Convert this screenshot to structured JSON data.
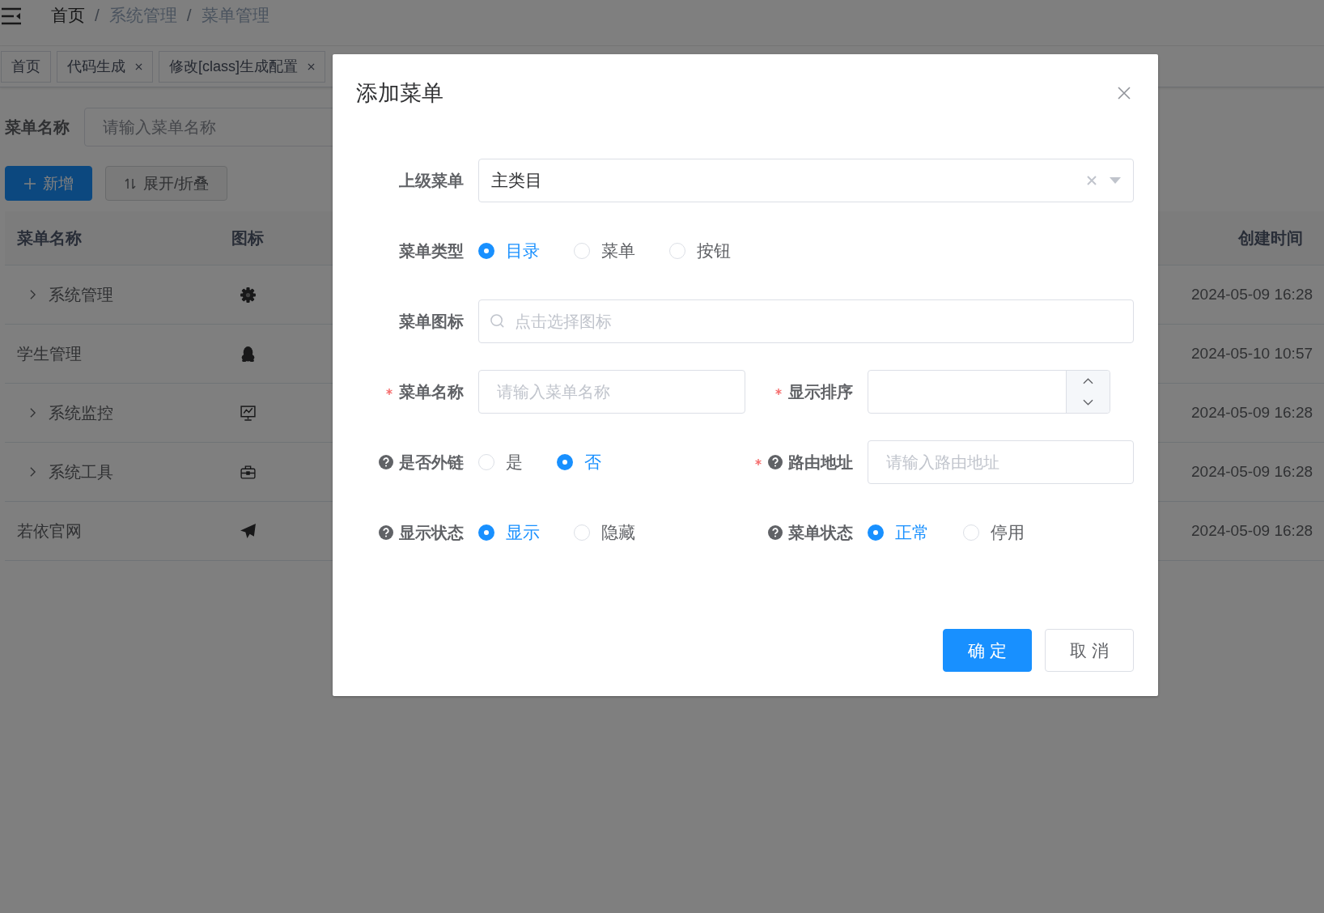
{
  "header": {
    "breadcrumb": [
      {
        "label": "首页",
        "link": true
      },
      {
        "label": "系统管理",
        "link": false
      },
      {
        "label": "菜单管理",
        "link": false
      }
    ],
    "separator": "/"
  },
  "tabs": [
    {
      "label": "首页",
      "closable": false
    },
    {
      "label": "代码生成",
      "closable": true
    },
    {
      "label": "修改[class]生成配置",
      "closable": true
    }
  ],
  "search": {
    "label": "菜单名称",
    "placeholder": "请输入菜单名称"
  },
  "toolbar": [
    {
      "label": "新增",
      "kind": "primary"
    },
    {
      "label": "展开/折叠",
      "kind": "plain"
    }
  ],
  "table": {
    "columns": [
      "菜单名称",
      "图标",
      "创建时间"
    ],
    "rows": [
      {
        "name": "系统管理",
        "expandable": true,
        "created": "2024-05-09 16:28"
      },
      {
        "name": "学生管理",
        "expandable": false,
        "created": "2024-05-10 10:57"
      },
      {
        "name": "系统监控",
        "expandable": true,
        "created": "2024-05-09 16:28"
      },
      {
        "name": "系统工具",
        "expandable": true,
        "created": "2024-05-09 16:28"
      },
      {
        "name": "若依官网",
        "expandable": false,
        "created": "2024-05-09 16:28"
      }
    ]
  },
  "dialog": {
    "title": "添加菜单",
    "rows": [
      [
        {
          "kind": "select",
          "label": "上级菜单",
          "required": false,
          "help": false,
          "value": "主类目"
        }
      ],
      [
        {
          "kind": "radio",
          "label": "菜单类型",
          "required": false,
          "help": false,
          "options": [
            {
              "label": "目录",
              "selected": true
            },
            {
              "label": "菜单",
              "selected": false
            },
            {
              "label": "按钮",
              "selected": false
            }
          ]
        }
      ],
      [
        {
          "kind": "icon-input",
          "label": "菜单图标",
          "required": false,
          "help": false,
          "placeholder": "点击选择图标"
        }
      ],
      [
        {
          "kind": "input",
          "label": "菜单名称",
          "required": true,
          "help": false,
          "placeholder": "请输入菜单名称"
        },
        {
          "kind": "number",
          "label": "显示排序",
          "required": true,
          "help": false
        }
      ],
      [
        {
          "kind": "radio",
          "label": "是否外链",
          "required": false,
          "help": true,
          "options": [
            {
              "label": "是",
              "selected": false
            },
            {
              "label": "否",
              "selected": true
            }
          ]
        },
        {
          "kind": "input",
          "label": "路由地址",
          "required": true,
          "help": true,
          "placeholder": "请输入路由地址"
        }
      ],
      [
        {
          "kind": "radio",
          "label": "显示状态",
          "required": false,
          "help": true,
          "options": [
            {
              "label": "显示",
              "selected": true
            },
            {
              "label": "隐藏",
              "selected": false
            }
          ]
        },
        {
          "kind": "radio",
          "label": "菜单状态",
          "required": false,
          "help": true,
          "options": [
            {
              "label": "正常",
              "selected": true
            },
            {
              "label": "停用",
              "selected": false
            }
          ]
        }
      ]
    ],
    "buttons": [
      {
        "label": "确 定",
        "kind": "primary"
      },
      {
        "label": "取 消",
        "kind": "default"
      }
    ]
  }
}
